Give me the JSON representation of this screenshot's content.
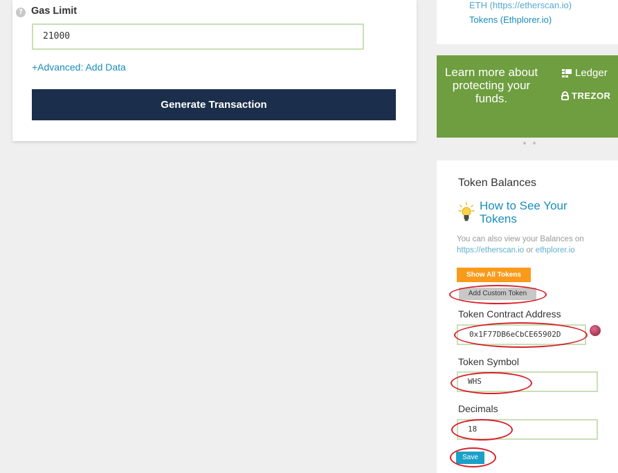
{
  "left_card": {
    "help_icon": "?",
    "gas_limit_label": "Gas Limit",
    "gas_limit_value": "21000",
    "advanced_link": "+Advanced: Add Data",
    "generate_button": "Generate Transaction"
  },
  "sidebar": {
    "links": {
      "etherscan_partial": "ETH (https://etherscan.io)",
      "ethplorer": "Tokens (Ethplorer.io)"
    },
    "promo": {
      "text": "Learn more about protecting your funds.",
      "ledger": "Ledger",
      "trezor": "TREZOR",
      "background_color": "#6e9e3f"
    },
    "token_balances": {
      "title": "Token Balances",
      "how_to_link": "How to See Your Tokens",
      "description_prefix": "You can also view your Balances on ",
      "etherscan_link": "https://etherscan.io",
      "description_or": " or ",
      "ethplorer_link": "ethplorer.io",
      "show_all_button": "Show All Tokens",
      "add_custom_button": "Add Custom Token",
      "contract_label": "Token Contract Address",
      "contract_value": "0x1F77DB6eCbCE65902D",
      "symbol_label": "Token Symbol",
      "symbol_value": "WHS",
      "decimals_label": "Decimals",
      "decimals_value": "18",
      "save_button": "Save"
    }
  },
  "colors": {
    "primary_button": "#1b2e4b",
    "link": "#1a8cbc",
    "show_all": "#f99a1a",
    "save": "#1ba1c8",
    "annotation": "#d9202a"
  }
}
